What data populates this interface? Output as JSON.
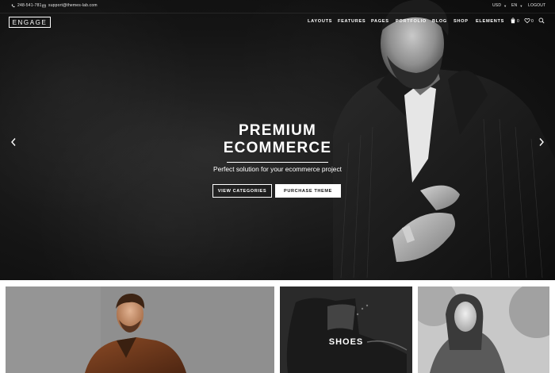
{
  "topbar": {
    "phone": "248-541-781",
    "email": "support@themes-lab.com",
    "currency": "USD",
    "language": "EN",
    "logout": "LOGOUT"
  },
  "brand": {
    "logo": "ENGAGE"
  },
  "nav": {
    "items": [
      "LAYOUTS",
      "FEATURES",
      "PAGES",
      "PORTFOLIO",
      "BLOG",
      "SHOP",
      "ELEMENTS"
    ],
    "cart_count": "0",
    "wishlist_count": "0"
  },
  "hero": {
    "title_line1": "PREMIUM",
    "title_line2": "ECOMMERCE",
    "subtitle": "Perfect solution for your ecommerce project",
    "btn_primary": "VIEW CATEGORIES",
    "btn_secondary": "PURCHASE THEME"
  },
  "categories": [
    {
      "label": ""
    },
    {
      "label": "SHOES"
    },
    {
      "label": ""
    }
  ],
  "icons": {
    "phone": "phone-icon",
    "email": "envelope-icon",
    "cart": "cart-icon",
    "wishlist": "heart-icon",
    "search": "search-icon",
    "prev": "chevron-left-icon",
    "next": "chevron-right-icon"
  },
  "colors": {
    "hero_bg": "#151515",
    "text": "#ffffff",
    "button_solid_bg": "#ffffff",
    "button_solid_text": "#111111"
  }
}
